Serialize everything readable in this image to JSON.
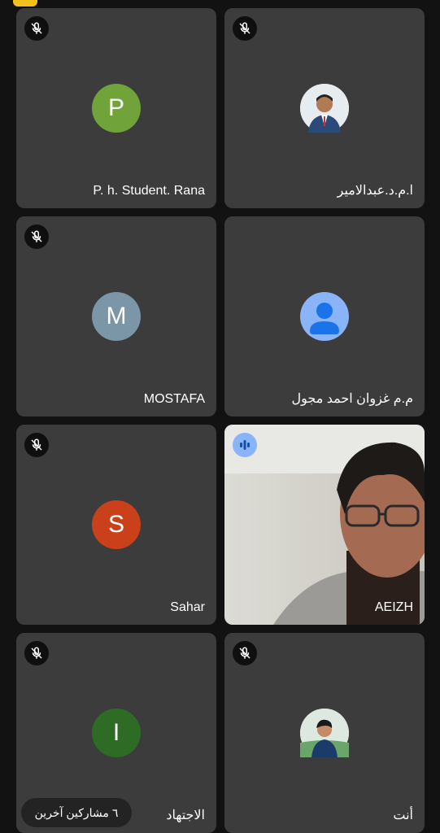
{
  "participants": [
    {
      "name": "P. h. Student. Rana",
      "initial": "P",
      "color": "#70a43a"
    },
    {
      "name": "ا.م.د.عبدالامير"
    },
    {
      "name": "MOSTAFA",
      "initial": "M",
      "color": "#7b96a6"
    },
    {
      "name": "م.م غزوان احمد مجول"
    },
    {
      "name": "Sahar",
      "initial": "S",
      "color": "#c9401b"
    },
    {
      "name": "AEIZH"
    },
    {
      "name": "الاجتهاد",
      "initial": "I",
      "color": "#2e6b25"
    },
    {
      "name": "أنت"
    }
  ],
  "others_label": "٦ مشاركين آخرين"
}
